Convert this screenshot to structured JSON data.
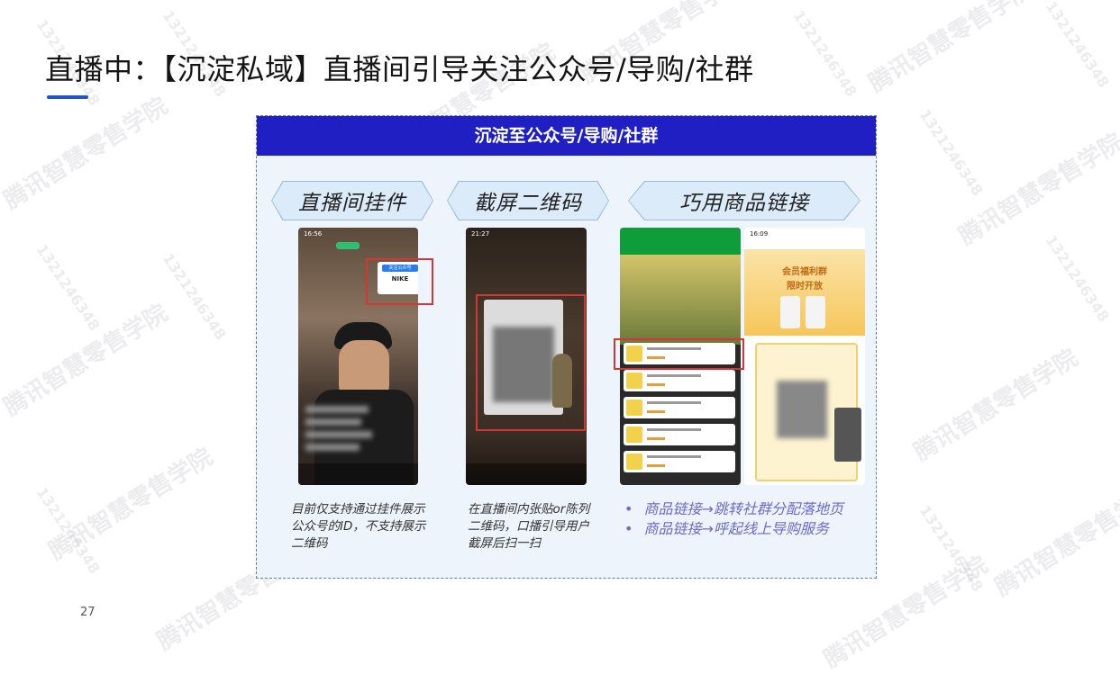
{
  "slide": {
    "title": "直播中：【沉淀私域】直播间引导关注公众号/导购/社群",
    "page_number": "27"
  },
  "watermark": {
    "brand_text": "腾讯智慧零售学院",
    "id_text": "1321246348"
  },
  "card": {
    "header": "沉淀至公众号/导购/社群",
    "sections": [
      {
        "label": "直播间挂件",
        "description": "目前仅支持通过挂件展示公众号的ID，不支持展示二维码"
      },
      {
        "label": "截屏二维码",
        "description": "在直播间内张贴or陈列二维码，口播引导用户截屏后扫一扫"
      },
      {
        "label": "巧用商品链接",
        "bullets": [
          "商品链接→跳转社群分配落地页",
          "商品链接→呼起线上导购服务"
        ]
      }
    ],
    "phone1": {
      "time": "16:56",
      "widget_text": "NIKE",
      "widget_label": "关注公众号"
    },
    "phone2": {
      "time": "21:27"
    },
    "phone3": {
      "time": "16:09",
      "group_title": "会员福利群",
      "banner_text": "限时开放"
    }
  },
  "colors": {
    "header_bg": "#1f1fc4",
    "accent_blue": "#1e56c8",
    "highlight_red": "#d43535",
    "bullet_purple": "#6a6ac8"
  }
}
